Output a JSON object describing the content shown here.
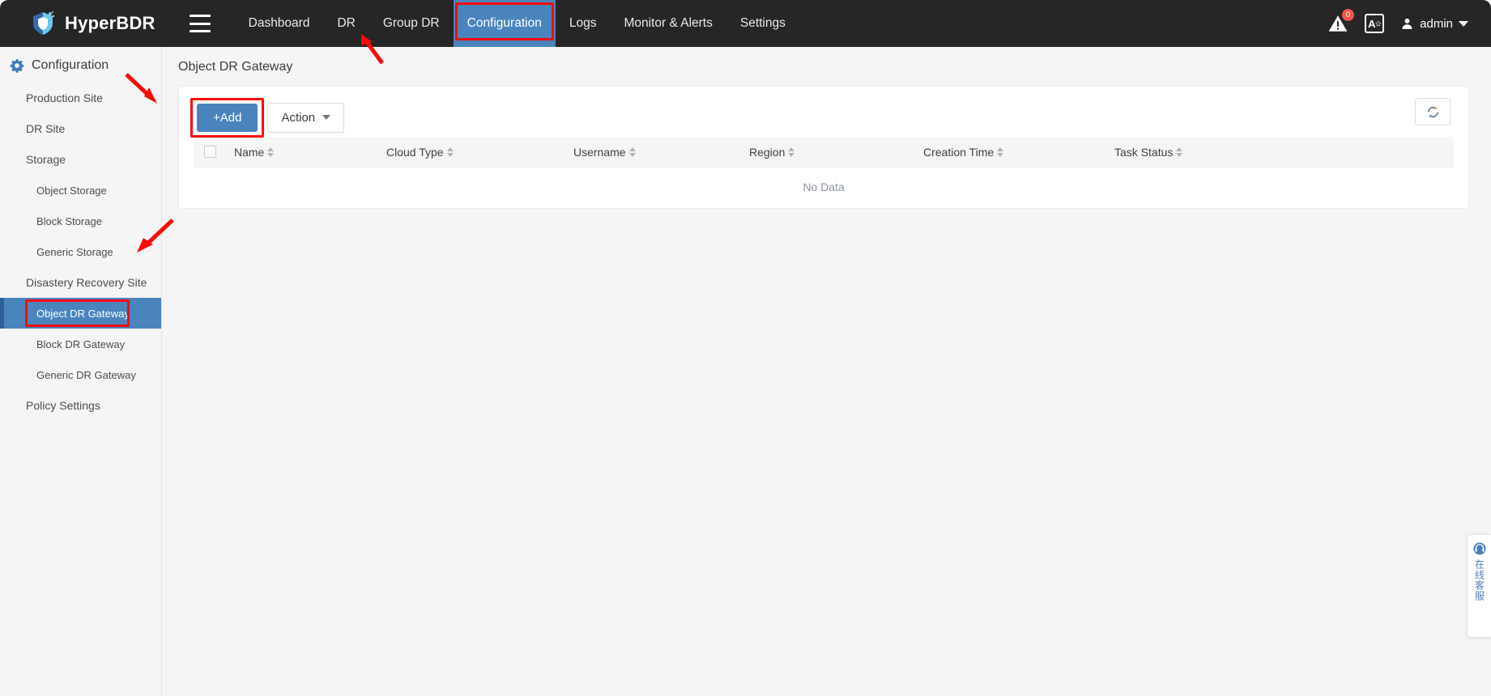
{
  "app": {
    "brand_name": "HyperBDR",
    "logo_icon": "shield-icon",
    "menu_icon": "hamburger-menu-icon"
  },
  "topnav": {
    "items": [
      {
        "label": "Dashboard",
        "active": false
      },
      {
        "label": "DR",
        "active": false
      },
      {
        "label": "Group DR",
        "active": false
      },
      {
        "label": "Configuration",
        "active": true
      },
      {
        "label": "Logs",
        "active": false
      },
      {
        "label": "Monitor & Alerts",
        "active": false
      },
      {
        "label": "Settings",
        "active": false
      }
    ],
    "alert_icon": "alert-warning-icon",
    "alert_count": "0",
    "language_icon": "language-switch-icon",
    "language_label": "A",
    "user_icon": "user-avatar-icon",
    "user_name": "admin",
    "user_caret_icon": "chevron-down-icon"
  },
  "sidebar": {
    "header": {
      "label": "Configuration",
      "icon": "gear-config-icon"
    },
    "items": [
      {
        "label": "Production Site",
        "level": 1,
        "active": false
      },
      {
        "label": "DR Site",
        "level": 1,
        "active": false
      },
      {
        "label": "Storage",
        "level": 1,
        "active": false
      },
      {
        "label": "Object Storage",
        "level": 2,
        "active": false
      },
      {
        "label": "Block Storage",
        "level": 2,
        "active": false
      },
      {
        "label": "Generic Storage",
        "level": 2,
        "active": false
      },
      {
        "label": "Disastery Recovery Site",
        "level": 1,
        "active": false
      },
      {
        "label": "Object DR Gateway",
        "level": 2,
        "active": true
      },
      {
        "label": "Block DR Gateway",
        "level": 2,
        "active": false
      },
      {
        "label": "Generic DR Gateway",
        "level": 2,
        "active": false
      },
      {
        "label": "Policy Settings",
        "level": 1,
        "active": false
      }
    ]
  },
  "main": {
    "page_title": "Object DR Gateway",
    "toolbar": {
      "add_label": "+Add",
      "action_label": "Action",
      "action_caret_icon": "chevron-down-icon",
      "refresh_icon": "refresh-icon"
    },
    "table": {
      "select_all_checkbox": "select-all-checkbox",
      "columns": [
        {
          "label": "Name",
          "sortable": true
        },
        {
          "label": "Cloud Type",
          "sortable": true
        },
        {
          "label": "Username",
          "sortable": true
        },
        {
          "label": "Region",
          "sortable": true
        },
        {
          "label": "Creation Time",
          "sortable": true
        },
        {
          "label": "Task Status",
          "sortable": true
        }
      ],
      "rows": [],
      "empty_text": "No Data"
    }
  },
  "service_widget": {
    "icon": "headset-support-icon",
    "label": "在线客服"
  },
  "colors": {
    "topbar_bg": "#262626",
    "accent_blue": "#4a84bd",
    "highlight_red": "#fb0a0a",
    "sidebar_bg": "#f5f5f5",
    "badge_red": "#f4524d"
  }
}
